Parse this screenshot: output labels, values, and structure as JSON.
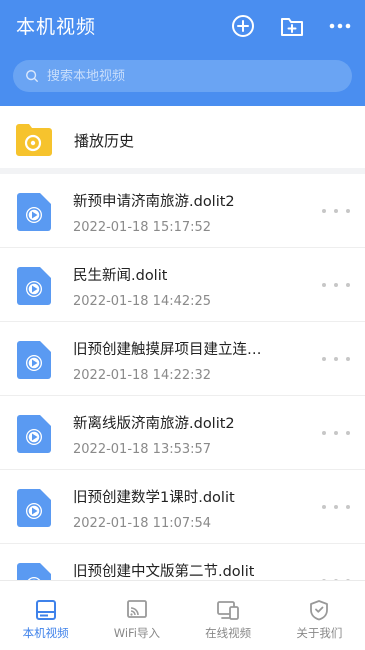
{
  "header": {
    "title": "本机视频",
    "add_icon": "plus-circle-icon",
    "folder_icon": "folder-add-icon",
    "more_icon": "more-horizontal-icon",
    "search_placeholder": "搜索本地视频"
  },
  "history": {
    "label": "播放历史",
    "icon": "folder-history-icon"
  },
  "videos": [
    {
      "title": "新预申请济南旅游.dolit2",
      "date": "2022-01-18 15:17:52"
    },
    {
      "title": "民生新闻.dolit",
      "date": "2022-01-18 14:42:25"
    },
    {
      "title": "旧预创建触摸屏项目建立连…",
      "date": "2022-01-18 14:22:32"
    },
    {
      "title": "新离线版济南旅游.dolit2",
      "date": "2022-01-18 13:53:57"
    },
    {
      "title": "旧预创建数学1课时.dolit",
      "date": "2022-01-18 11:07:54"
    },
    {
      "title": "旧预创建中文版第二节.dolit",
      "date": ""
    }
  ],
  "tabs": [
    {
      "label": "本机视频",
      "icon": "drive-icon",
      "active": true
    },
    {
      "label": "WiFi导入",
      "icon": "cast-icon",
      "active": false
    },
    {
      "label": "在线视频",
      "icon": "devices-icon",
      "active": false
    },
    {
      "label": "关于我们",
      "icon": "shield-icon",
      "active": false
    }
  ],
  "colors": {
    "primary": "#4a8ef0",
    "tab_active": "#3f82ea",
    "folder": "#f6c32d"
  }
}
